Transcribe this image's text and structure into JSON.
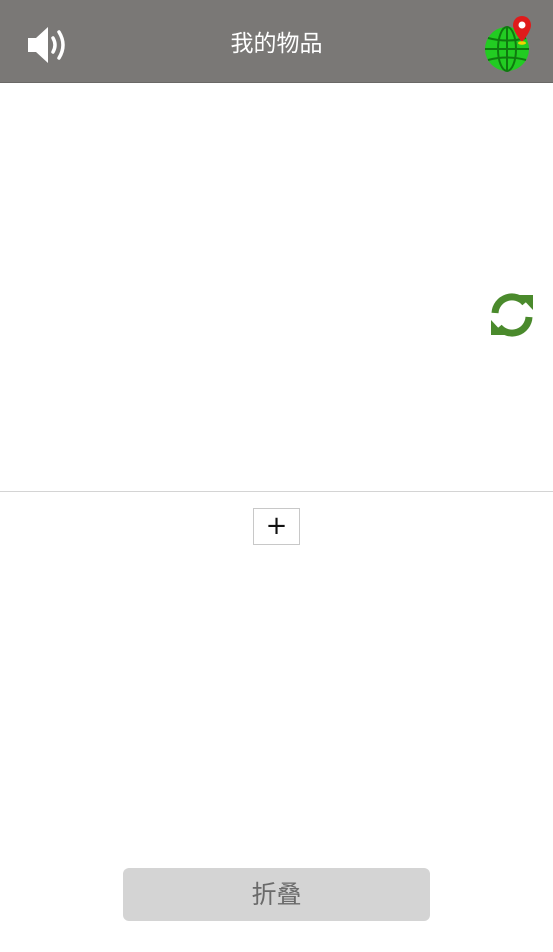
{
  "header": {
    "title": "我的物品",
    "speaker_icon": "speaker-volume-icon",
    "globe_icon": "globe-location-pin-icon"
  },
  "main": {
    "refresh_icon": "refresh-icon",
    "add_label": "+"
  },
  "footer": {
    "collapse_label": "折叠"
  },
  "colors": {
    "header_bg": "#7a7876",
    "refresh_green": "#4a8a2c",
    "globe_green": "#22cc22",
    "pin_red": "#e01b1b",
    "collapse_bg": "#d4d4d4"
  }
}
